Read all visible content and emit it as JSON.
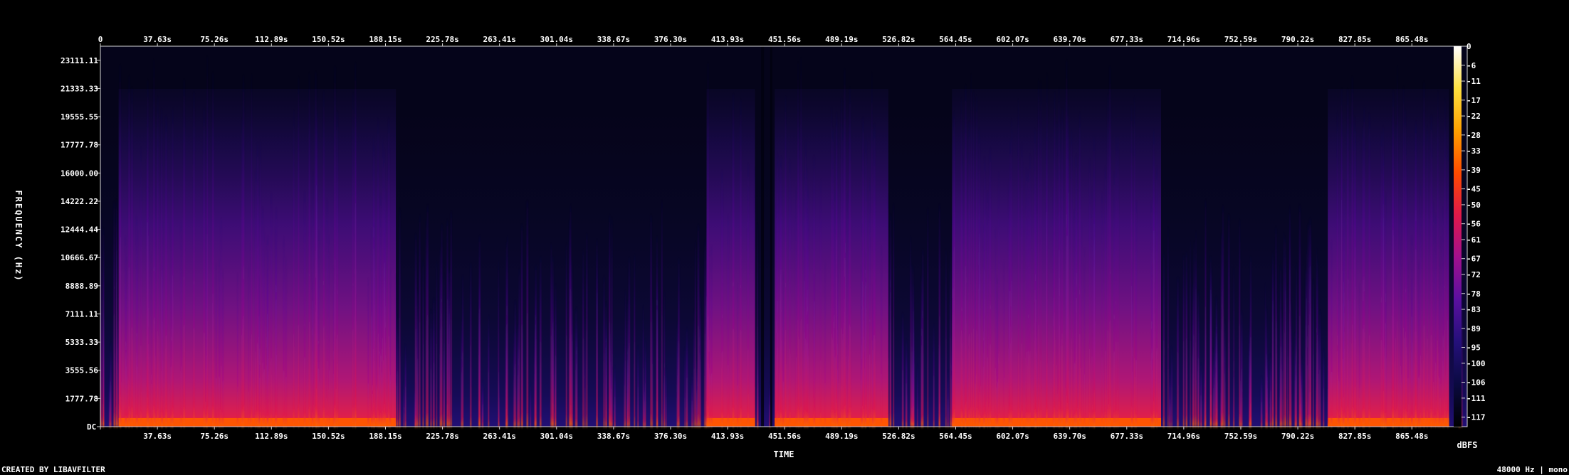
{
  "chart_data": {
    "type": "heatmap",
    "x_ticks": [
      "0",
      "37.63s",
      "75.26s",
      "112.89s",
      "150.52s",
      "188.15s",
      "225.78s",
      "263.41s",
      "301.04s",
      "338.67s",
      "376.30s",
      "413.93s",
      "451.56s",
      "489.19s",
      "526.82s",
      "564.45s",
      "602.07s",
      "639.70s",
      "677.33s",
      "714.96s",
      "752.59s",
      "790.22s",
      "827.85s",
      "865.48s"
    ],
    "x_tick_values": [
      0,
      37.63,
      75.26,
      112.89,
      150.52,
      188.15,
      225.78,
      263.41,
      301.04,
      338.67,
      376.3,
      413.93,
      451.56,
      489.19,
      526.82,
      564.45,
      602.07,
      639.7,
      677.33,
      714.96,
      752.59,
      790.22,
      827.85,
      865.48
    ],
    "bottom_first_tick": "DC",
    "y_ticks": [
      "23111.11",
      "21333.33",
      "19555.55",
      "17777.78",
      "16000.00",
      "14222.22",
      "12444.44",
      "10666.67",
      "8888.89",
      "7111.11",
      "5333.33",
      "3555.56",
      "1777.78"
    ],
    "y_tick_values": [
      23111.11,
      21333.33,
      19555.55,
      17777.78,
      16000.0,
      14222.22,
      12444.44,
      10666.67,
      8888.89,
      7111.11,
      5333.33,
      3555.56,
      1777.78,
      0
    ],
    "xlabel": "TIME",
    "ylabel": "FREQUENCY (Hz)",
    "xlim": [
      0,
      902
    ],
    "ylim": [
      0,
      24000
    ],
    "colorbar": {
      "unit": "dBFS",
      "ticks": [
        "0",
        "-6",
        "-11",
        "-17",
        "-22",
        "-28",
        "-33",
        "-39",
        "-45",
        "-50",
        "-56",
        "-61",
        "-67",
        "-72",
        "-78",
        "-83",
        "-89",
        "-95",
        "-100",
        "-106",
        "-111",
        "-117"
      ],
      "tick_values": [
        0,
        -6,
        -11,
        -17,
        -22,
        -28,
        -33,
        -39,
        -45,
        -50,
        -56,
        -61,
        -67,
        -72,
        -78,
        -83,
        -89,
        -95,
        -100,
        -106,
        -111,
        -117
      ],
      "range": [
        -120,
        0
      ],
      "colors": [
        "#000000",
        "#0a0a40",
        "#24107a",
        "#5a10a0",
        "#a0108e",
        "#e0184a",
        "#ff4a00",
        "#ffa000",
        "#ffe040",
        "#ffffff"
      ]
    },
    "loud_segments_s": [
      [
        12,
        195
      ],
      [
        400,
        432
      ],
      [
        445,
        520
      ],
      [
        562,
        700
      ],
      [
        810,
        890
      ]
    ]
  },
  "footer": {
    "left": "CREATED BY LIBAVFILTER",
    "right": "48000 Hz | mono"
  }
}
